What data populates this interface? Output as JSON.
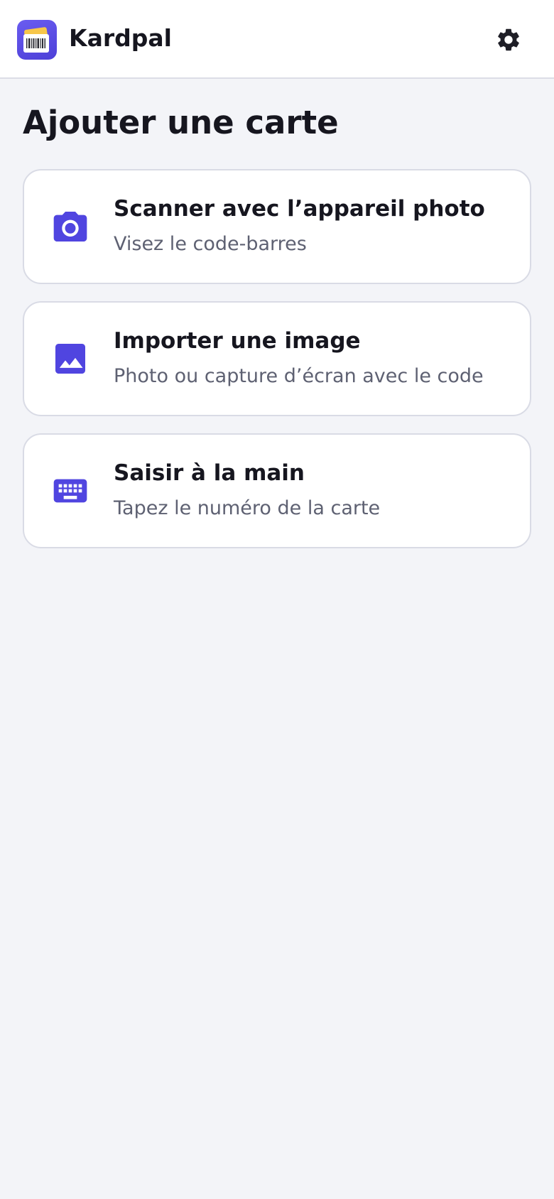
{
  "header": {
    "app_name": "Kardpal",
    "logo_icon": "barcode-card-logo",
    "settings_icon": "gear-icon"
  },
  "page": {
    "title": "Ajouter une carte"
  },
  "options": [
    {
      "icon": "camera-icon",
      "title": "Scanner avec l’appareil photo",
      "subtitle": "Visez le code-barres"
    },
    {
      "icon": "image-icon",
      "title": "Importer une image",
      "subtitle": "Photo ou capture d’écran avec le code"
    },
    {
      "icon": "keyboard-icon",
      "title": "Saisir à la main",
      "subtitle": "Tapez le numéro de la carte"
    }
  ],
  "colors": {
    "accent": "#5045e0",
    "background": "#f3f4f8",
    "card": "#ffffff",
    "text_primary": "#16161f",
    "text_secondary": "#5e6172",
    "logo_card": "#f7c64a"
  }
}
